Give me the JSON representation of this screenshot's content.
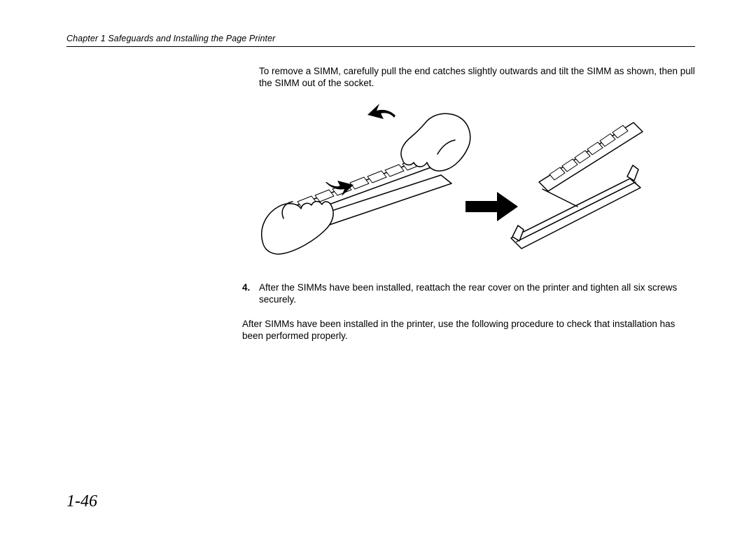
{
  "header": {
    "chapter": "Chapter 1 Safeguards and Installing the Page Printer"
  },
  "body": {
    "intro": "To remove a SIMM, carefully pull the end catches slightly outwards and tilt the SIMM as shown, then pull the SIMM out of the socket.",
    "step4_num": "4.",
    "step4_text": "After the SIMMs have been installed, reattach the rear cover on the printer and tighten all six screws securely.",
    "post": "After SIMMs have been installed in the printer, use the following procedure to check that installation has been performed properly."
  },
  "page_number": "1-46",
  "figure_alt": "Hands pulling end catches of a SIMM memory module outward and tilting it, with an arrow indicating removal from its socket."
}
